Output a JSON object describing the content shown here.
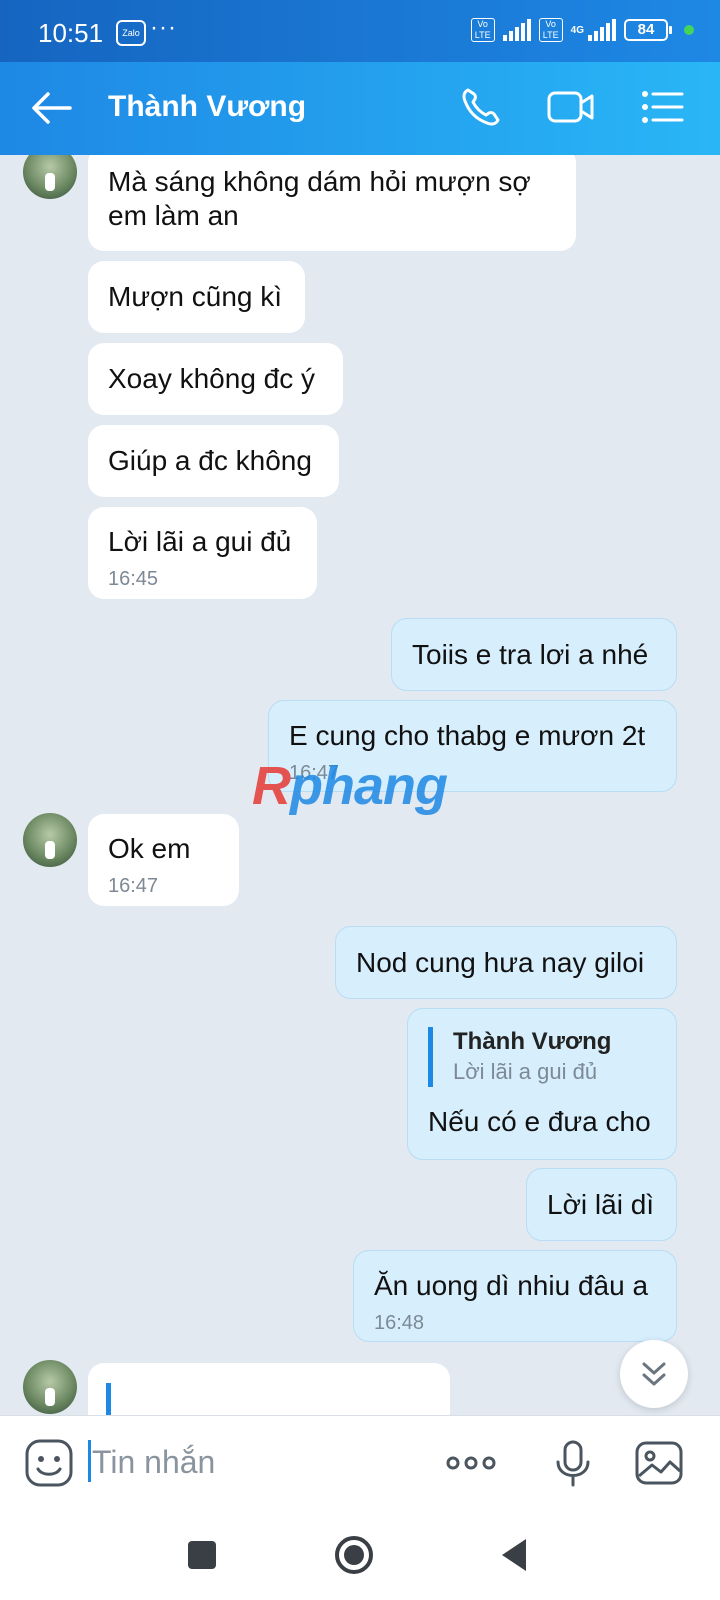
{
  "status_bar": {
    "time": "10:51",
    "app_badge": "Zalo",
    "more": "···",
    "volte1": "Vo LTE",
    "volte2": "Vo LTE",
    "network": "4G",
    "battery": "84"
  },
  "header": {
    "contact_name": "Thành Vương",
    "icons": [
      "back-arrow-icon",
      "phone-icon",
      "video-call-icon",
      "menu-list-icon"
    ],
    "color": "#1e88e5"
  },
  "messages": [
    {
      "side": "in",
      "text_line1": "Mà sáng không dám hỏi mượn sợ",
      "text_line2": "em làm an"
    },
    {
      "side": "in",
      "text": "Mượn cũng kì"
    },
    {
      "side": "in",
      "text": "Xoay không đc ý"
    },
    {
      "side": "in",
      "text": "Giúp a đc không"
    },
    {
      "side": "in",
      "text": "Lời lãi a gui đủ",
      "time": "16:45"
    },
    {
      "side": "out",
      "text": "Toiis e tra lơi a nhé"
    },
    {
      "side": "out",
      "text": "E cung cho thabg e mươn 2t",
      "time": "16:47"
    },
    {
      "side": "in",
      "text": "Ok em",
      "time": "16:47"
    },
    {
      "side": "out",
      "text": "Nod cung hưa nay giloi"
    },
    {
      "side": "out",
      "quote_name": "Thành Vương",
      "quote_text": "Lời lãi a gui đủ",
      "text": "Nếu có e đưa cho"
    },
    {
      "side": "out",
      "text": "Lời lãi dì"
    },
    {
      "side": "out",
      "text": "Ăn uong dì nhiu đâu a",
      "time": "16:48"
    }
  ],
  "watermark": {
    "first": "R",
    "rest": "phang"
  },
  "input": {
    "placeholder": "Tin nhắn",
    "icons": [
      "sticker-icon",
      "more-dots-icon",
      "microphone-icon",
      "image-icon"
    ]
  },
  "nav": {
    "icons": [
      "recents-square-icon",
      "home-circle-icon",
      "back-triangle-icon"
    ]
  }
}
